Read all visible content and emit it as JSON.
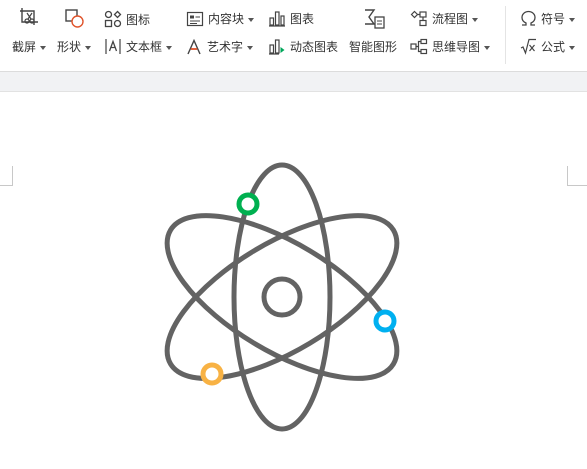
{
  "ribbon": {
    "screenshot": {
      "label": "截屏",
      "icon": "screenshot-icon"
    },
    "shapes": {
      "label": "形状",
      "icon": "shapes-icon"
    },
    "icons": {
      "label": "图标",
      "icon": "icon-library-icon"
    },
    "textbox": {
      "label": "文本框",
      "icon": "textbox-icon"
    },
    "content_block": {
      "label": "内容块",
      "icon": "content-block-icon"
    },
    "wordart": {
      "label": "艺术字",
      "icon": "wordart-icon"
    },
    "chart": {
      "label": "图表",
      "icon": "chart-icon"
    },
    "dynamic_chart": {
      "label": "动态图表",
      "icon": "dynamic-chart-icon"
    },
    "smart_graphic": {
      "label": "智能图形",
      "icon": "smart-graphic-icon"
    },
    "flowchart": {
      "label": "流程图",
      "icon": "flowchart-icon"
    },
    "mindmap": {
      "label": "思维导图",
      "icon": "mindmap-icon"
    },
    "symbol": {
      "label": "符号",
      "icon": "omega-icon"
    },
    "formula": {
      "label": "公式",
      "icon": "formula-icon"
    }
  },
  "document": {
    "graphic": "atom-icon",
    "colors": {
      "line": "#636363",
      "green": "#00b050",
      "blue": "#00b0f0",
      "orange": "#f8b244"
    }
  }
}
